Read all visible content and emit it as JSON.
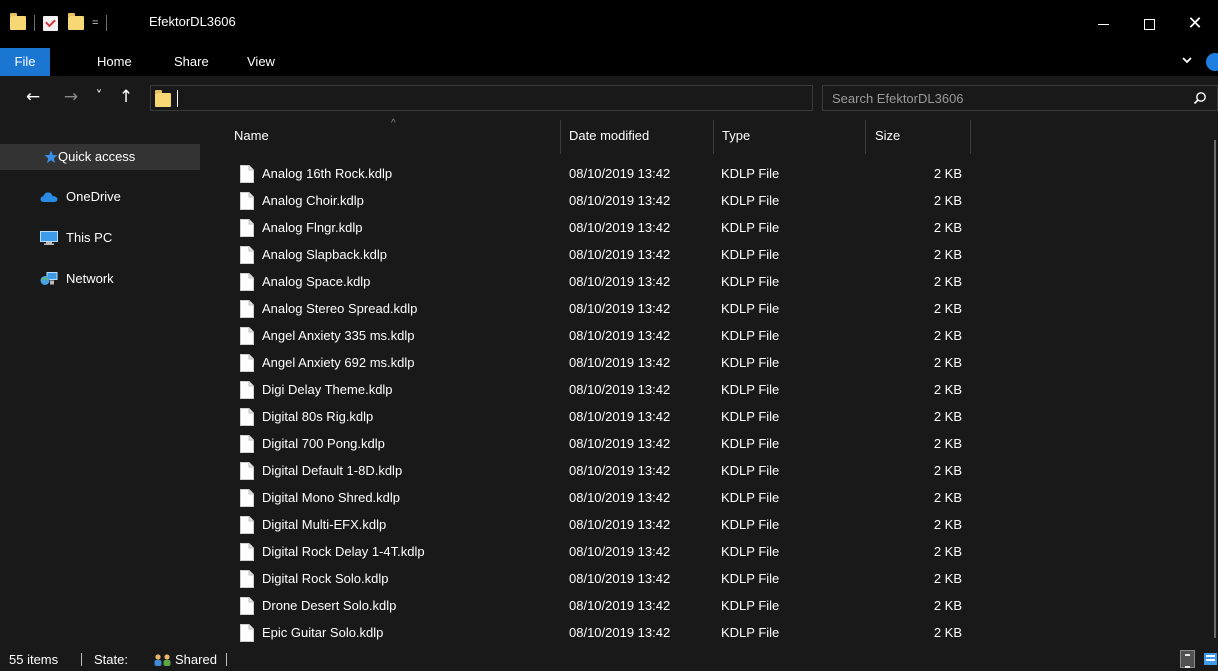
{
  "window": {
    "title": "EfektorDL3606",
    "qat_dropdown": "=",
    "minimize_label": "",
    "close_glyph": "✕"
  },
  "ribbon": {
    "tabs": [
      "File",
      "Home",
      "Share",
      "View"
    ]
  },
  "nav": {
    "back": "←",
    "forward": "→",
    "recent": "˅",
    "up": "↑"
  },
  "address": {
    "value": "",
    "dropdown_glyph": "⌵",
    "go_glyph": "→"
  },
  "search": {
    "placeholder": "Search EfektorDL3606"
  },
  "navpane": {
    "items": [
      {
        "label": "Quick access",
        "icon": "star-icon",
        "selected": true
      },
      {
        "label": "OneDrive",
        "icon": "cloud-icon"
      },
      {
        "label": "This PC",
        "icon": "monitor-icon"
      },
      {
        "label": "Network",
        "icon": "network-icon"
      }
    ]
  },
  "columns": {
    "name": "Name",
    "date": "Date modified",
    "type": "Type",
    "size": "Size",
    "sort_glyph": "^"
  },
  "files": [
    {
      "name": "Analog 16th Rock.kdlp",
      "date": "08/10/2019 13:42",
      "type": "KDLP File",
      "size": "2 KB"
    },
    {
      "name": "Analog Choir.kdlp",
      "date": "08/10/2019 13:42",
      "type": "KDLP File",
      "size": "2 KB"
    },
    {
      "name": "Analog Flngr.kdlp",
      "date": "08/10/2019 13:42",
      "type": "KDLP File",
      "size": "2 KB"
    },
    {
      "name": "Analog Slapback.kdlp",
      "date": "08/10/2019 13:42",
      "type": "KDLP File",
      "size": "2 KB"
    },
    {
      "name": "Analog Space.kdlp",
      "date": "08/10/2019 13:42",
      "type": "KDLP File",
      "size": "2 KB"
    },
    {
      "name": "Analog Stereo Spread.kdlp",
      "date": "08/10/2019 13:42",
      "type": "KDLP File",
      "size": "2 KB"
    },
    {
      "name": "Angel Anxiety 335 ms.kdlp",
      "date": "08/10/2019 13:42",
      "type": "KDLP File",
      "size": "2 KB"
    },
    {
      "name": "Angel Anxiety 692 ms.kdlp",
      "date": "08/10/2019 13:42",
      "type": "KDLP File",
      "size": "2 KB"
    },
    {
      "name": "Digi Delay Theme.kdlp",
      "date": "08/10/2019 13:42",
      "type": "KDLP File",
      "size": "2 KB"
    },
    {
      "name": "Digital 80s Rig.kdlp",
      "date": "08/10/2019 13:42",
      "type": "KDLP File",
      "size": "2 KB"
    },
    {
      "name": "Digital 700 Pong.kdlp",
      "date": "08/10/2019 13:42",
      "type": "KDLP File",
      "size": "2 KB"
    },
    {
      "name": "Digital Default 1-8D.kdlp",
      "date": "08/10/2019 13:42",
      "type": "KDLP File",
      "size": "2 KB"
    },
    {
      "name": "Digital Mono Shred.kdlp",
      "date": "08/10/2019 13:42",
      "type": "KDLP File",
      "size": "2 KB"
    },
    {
      "name": "Digital Multi-EFX.kdlp",
      "date": "08/10/2019 13:42",
      "type": "KDLP File",
      "size": "2 KB"
    },
    {
      "name": "Digital Rock Delay 1-4T.kdlp",
      "date": "08/10/2019 13:42",
      "type": "KDLP File",
      "size": "2 KB"
    },
    {
      "name": "Digital Rock Solo.kdlp",
      "date": "08/10/2019 13:42",
      "type": "KDLP File",
      "size": "2 KB"
    },
    {
      "name": "Drone Desert Solo.kdlp",
      "date": "08/10/2019 13:42",
      "type": "KDLP File",
      "size": "2 KB"
    },
    {
      "name": "Epic Guitar Solo.kdlp",
      "date": "08/10/2019 13:42",
      "type": "KDLP File",
      "size": "2 KB"
    }
  ],
  "status": {
    "items_count": "55 items",
    "state_label": "State:",
    "state_value": "Shared"
  },
  "colors": {
    "background": "#191919",
    "titlebar": "#000000",
    "accent": "#1a76d1",
    "folder": "#f8d775",
    "selected": "#333333"
  }
}
